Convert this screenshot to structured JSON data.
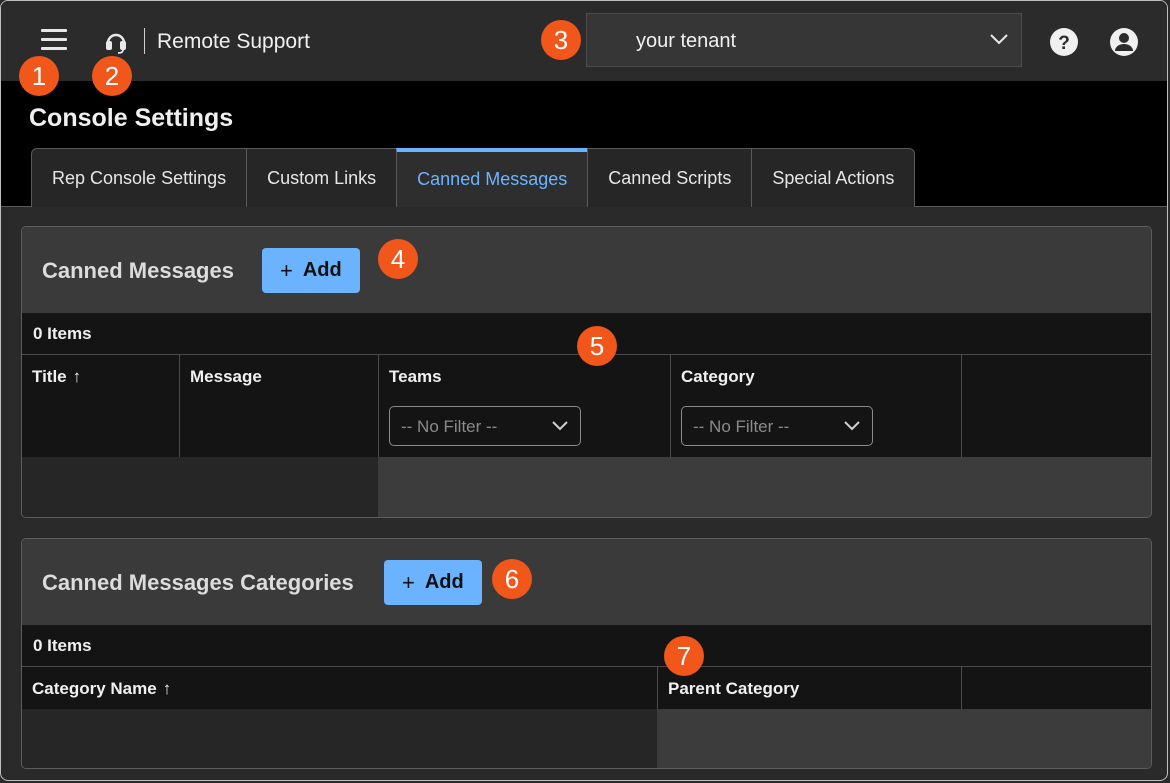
{
  "topbar": {
    "brand": "Remote Support",
    "tenant": "your tenant"
  },
  "page": {
    "title": "Console Settings"
  },
  "tabs": [
    {
      "label": "Rep Console Settings"
    },
    {
      "label": "Custom Links"
    },
    {
      "label": "Canned Messages",
      "active": true
    },
    {
      "label": "Canned Scripts"
    },
    {
      "label": "Special Actions"
    }
  ],
  "canned_messages": {
    "title": "Canned Messages",
    "add_label": "Add",
    "items_count": "0 Items",
    "columns": [
      "Title",
      "Message",
      "Teams",
      "Category"
    ],
    "teams_filter": "-- No Filter --",
    "category_filter": "-- No Filter --"
  },
  "categories": {
    "title": "Canned Messages Categories",
    "add_label": "Add",
    "items_count": "0 Items",
    "columns": [
      "Category Name",
      "Parent Category"
    ]
  },
  "markers": [
    "1",
    "2",
    "3",
    "4",
    "5",
    "6",
    "7"
  ],
  "colors": {
    "accent": "#6cb3ff",
    "marker": "#f1561b",
    "header_bg": "#000000",
    "topbar_bg": "#2b2b2b"
  },
  "icons": {
    "menu": "hamburger-icon",
    "logo": "headset-icon",
    "dropdown": "chevron-down-icon",
    "help": "help-icon",
    "user": "user-icon",
    "sort": "arrow-up-icon",
    "add": "plus-icon"
  }
}
